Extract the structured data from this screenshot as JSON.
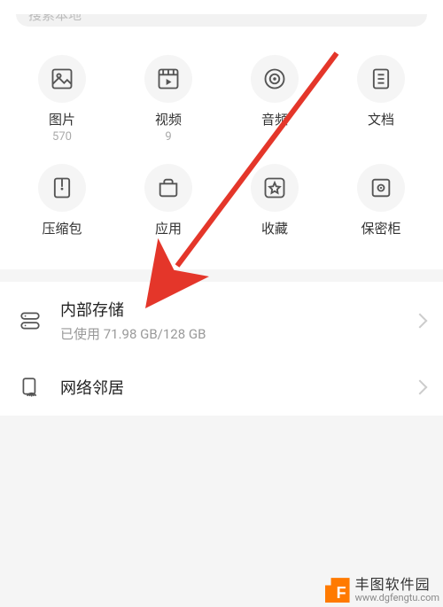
{
  "search": {
    "placeholder": "搜索本地"
  },
  "categories": [
    {
      "key": "images",
      "label": "图片",
      "count": "570"
    },
    {
      "key": "videos",
      "label": "视频",
      "count": "9"
    },
    {
      "key": "audio",
      "label": "音频",
      "count": ""
    },
    {
      "key": "docs",
      "label": "文档",
      "count": ""
    },
    {
      "key": "archives",
      "label": "压缩包",
      "count": ""
    },
    {
      "key": "apps",
      "label": "应用",
      "count": ""
    },
    {
      "key": "fav",
      "label": "收藏",
      "count": ""
    },
    {
      "key": "safe",
      "label": "保密柜",
      "count": ""
    }
  ],
  "storage": {
    "title": "内部存储",
    "subtitle": "已使用 71.98 GB/128 GB"
  },
  "network": {
    "title": "网络邻居"
  },
  "watermark": {
    "name": "丰图软件园",
    "url": "www.dgfengtu.com"
  }
}
